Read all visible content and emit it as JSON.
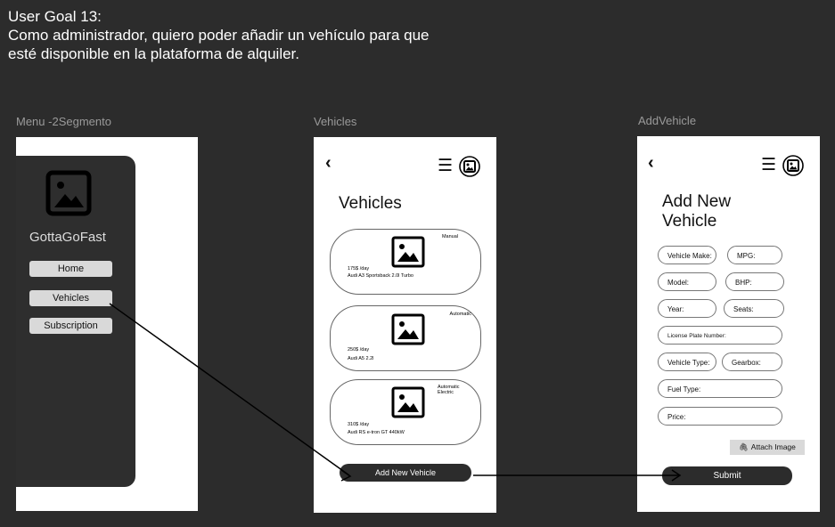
{
  "goal": {
    "line1": "User Goal 13:",
    "line2": "Como administrador, quiero poder añadir un vehículo para que",
    "line3": "esté disponible en la plataforma de alquiler."
  },
  "frames": {
    "menu": {
      "label": "Menu -2Segmento",
      "brand": "GottaGoFast",
      "items": [
        "Home",
        "Vehicles",
        "Subscription"
      ]
    },
    "vehicles": {
      "label": "Vehicles",
      "back": "‹",
      "title": "Vehicles",
      "cards": [
        {
          "tag": "Manual",
          "price": "175$ /day",
          "name": "Audi A3 Sportsback 2.0l Turbo"
        },
        {
          "tag": "Automatic",
          "price": "250$ /day",
          "name": "Audi A5 2.2l"
        },
        {
          "tag": "Automatic Electric",
          "price": "310$ /day",
          "name": "Audi RS e-tron GT 440kW"
        }
      ],
      "add_button": "Add New Vehicle"
    },
    "add_vehicle": {
      "label": "AddVehicle",
      "back": "‹",
      "title_line1": "Add New",
      "title_line2": "Vehicle",
      "fields": {
        "make": "Vehicle Make:",
        "mpg": "MPG:",
        "model": "Model:",
        "bhp": "BHP:",
        "year": "Year:",
        "seats": "Seats:",
        "plate": "License Plate Number:",
        "type": "Vehicle Type:",
        "gearbox": "Gearbox:",
        "fuel": "Fuel Type:",
        "price": "Price:"
      },
      "attach": "Attach Image",
      "submit": "Submit"
    }
  },
  "icons": {
    "image_placeholder": "image-icon",
    "menu": "hamburger-icon",
    "profile": "profile-image-icon",
    "back": "chevron-left-icon",
    "attach": "paperclip-icon"
  }
}
